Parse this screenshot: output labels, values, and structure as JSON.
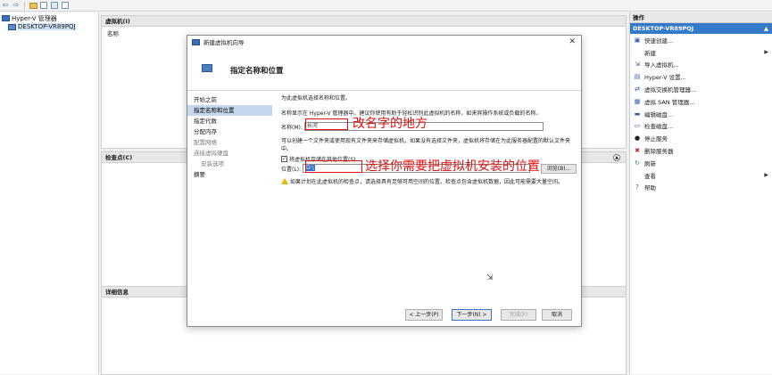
{
  "toolbar": {
    "icons": [
      "back-arrow-icon",
      "forward-arrow-icon",
      "folder-icon",
      "console-icon",
      "help-icon",
      "mmc-icon"
    ]
  },
  "tree": {
    "root": "Hyper-V 管理器",
    "child": "DESKTOP-VR89PQJ"
  },
  "panels": {
    "vms": {
      "title": "虚拟机(I)",
      "column": "名称"
    },
    "checkpoints": {
      "title": "检查点(C)"
    },
    "details": {
      "title": "详细信息"
    }
  },
  "actions": {
    "title": "操作",
    "host": "DESKTOP-VR89PQJ",
    "items": [
      {
        "label": "快速创建...",
        "icon": "quick-create-icon"
      },
      {
        "label": "新建",
        "icon": "none",
        "submenu": true
      },
      {
        "label": "导入虚拟机...",
        "icon": "import-icon"
      },
      {
        "label": "Hyper-V 设置...",
        "icon": "settings-icon"
      },
      {
        "label": "虚拟交换机管理器...",
        "icon": "switch-icon"
      },
      {
        "label": "虚拟 SAN 管理器...",
        "icon": "san-icon"
      },
      {
        "label": "编辑磁盘...",
        "icon": "edit-disk-icon"
      },
      {
        "label": "检查磁盘...",
        "icon": "inspect-disk-icon"
      },
      {
        "label": "停止服务",
        "icon": "stop-icon"
      },
      {
        "label": "删除服务器",
        "icon": "delete-icon"
      },
      {
        "label": "刷新",
        "icon": "refresh-icon"
      },
      {
        "label": "查看",
        "icon": "none",
        "submenu": true
      },
      {
        "label": "帮助",
        "icon": "help-icon"
      }
    ]
  },
  "dialog": {
    "title": "新建虚拟机向导",
    "heading": "指定名称和位置",
    "steps": [
      {
        "label": "开始之前",
        "state": "normal"
      },
      {
        "label": "指定名称和位置",
        "state": "active"
      },
      {
        "label": "指定代数",
        "state": "normal"
      },
      {
        "label": "分配内存",
        "state": "normal"
      },
      {
        "label": "配置网络",
        "state": "muted"
      },
      {
        "label": "连接虚拟硬盘",
        "state": "muted"
      },
      {
        "label": "安装选项",
        "state": "sub"
      },
      {
        "label": "摘要",
        "state": "normal"
      }
    ],
    "intro": "为此虚拟机选择名称和位置。",
    "name_help": "名称显示在 Hyper-V 管理器中。建议你使用有助于轻松识别此虚拟机的名称，如来宾操作系统或负载的名称。",
    "name_label": "名称(M):",
    "name_value": "长河",
    "location_help": "可以创建一个文件夹或使用现有文件夹来存储虚拟机。如果没有选择文件夹，虚拟机将存储在为此服务器配置的默认文件夹中。",
    "store_checkbox": "将虚拟机存储在其他位置(S)",
    "location_label": "位置(L):",
    "location_value": "D:\\",
    "browse": "浏览(B)...",
    "warning": "如果计划在此虚拟机的检查点，请选择具有足够可用空间的位置。检查点包含虚拟机数据，因此可能需要大量空间。",
    "buttons": {
      "prev": "< 上一步(P)",
      "next": "下一步(N) >",
      "finish": "完成(F)",
      "cancel": "取消"
    }
  },
  "annotations": {
    "name_note": "改名字的地方",
    "location_note": "选择你需要把虚拟机安装的位置"
  }
}
